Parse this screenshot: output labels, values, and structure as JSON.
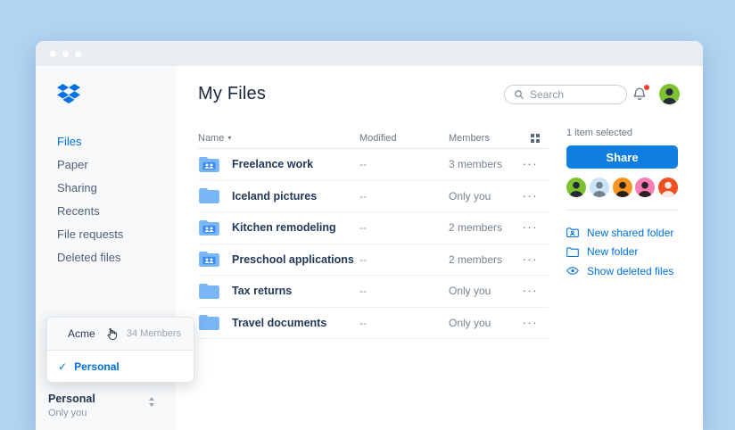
{
  "header": {
    "title": "My Files",
    "search_placeholder": "Search"
  },
  "sidebar": {
    "items": [
      {
        "label": "Files",
        "active": true
      },
      {
        "label": "Paper"
      },
      {
        "label": "Sharing"
      },
      {
        "label": "Recents"
      },
      {
        "label": "File requests"
      },
      {
        "label": "Deleted files"
      }
    ],
    "account": {
      "name": "Personal",
      "detail": "Only you"
    }
  },
  "table": {
    "columns": {
      "name": "Name",
      "modified": "Modified",
      "members": "Members"
    },
    "rows": [
      {
        "name": "Freelance work",
        "shared": true,
        "modified": "--",
        "members": "3 members"
      },
      {
        "name": "Iceland pictures",
        "shared": false,
        "modified": "--",
        "members": "Only you"
      },
      {
        "name": "Kitchen remodeling",
        "shared": true,
        "modified": "--",
        "members": "2 members"
      },
      {
        "name": "Preschool applications",
        "shared": true,
        "modified": "--",
        "members": "2 members"
      },
      {
        "name": "Tax returns",
        "shared": false,
        "modified": "--",
        "members": "Only you"
      },
      {
        "name": "Travel documents",
        "shared": false,
        "modified": "--",
        "members": "Only you"
      }
    ]
  },
  "panel": {
    "selected_text": "1 item selected",
    "share_label": "Share",
    "avatars": [
      {
        "bg": "#7ec131",
        "fg": "#232c38"
      },
      {
        "bg": "#c9e4f6",
        "fg": "#77838f"
      },
      {
        "bg": "#f5941e",
        "fg": "#27211c"
      },
      {
        "bg": "#f97cb4",
        "fg": "#2b2326"
      },
      {
        "bg": "#ee4f23",
        "fg": "#f4ece4"
      }
    ],
    "actions": [
      {
        "label": "New shared folder"
      },
      {
        "label": "New folder"
      },
      {
        "label": "Show deleted files"
      }
    ]
  },
  "popup": {
    "org_label": "Acme",
    "org_meta": "34 Members",
    "selected_label": "Personal"
  },
  "icons": {
    "sort_desc": "▾",
    "check": "✓",
    "ellipsis": "···"
  },
  "colors": {
    "page_bg": "#b1d5f2",
    "accent_blue": "#0070e0",
    "share_button": "#0f7ee0",
    "folder_blue": "#79b6f6",
    "folder_badge_blue": "#3e8cf0",
    "notification_red": "#fa3b30",
    "top_avatar_bg": "#7ec131"
  }
}
